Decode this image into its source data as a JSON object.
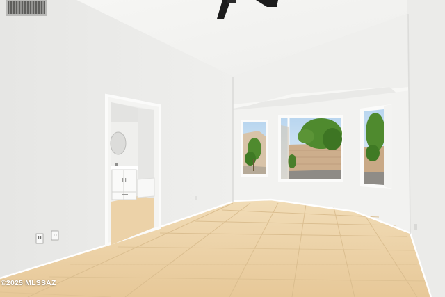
{
  "photo": {
    "subject": "empty-bedroom-interior",
    "watermark": "©2025 MLSSAZ"
  },
  "colors": {
    "wall_left": "#ececea",
    "wall_back": "#f1f1ef",
    "ceiling": "#f3f3f1",
    "floor_tile": "#ecd2a8",
    "grout": "#dcbf92",
    "foliage": "#4f8a2e",
    "sky": "#cfe3f3",
    "fan": "#1c1c1c"
  },
  "icons": [
    "ceiling-fan-icon",
    "air-vent-icon",
    "outlet-icon",
    "mirror-icon"
  ]
}
